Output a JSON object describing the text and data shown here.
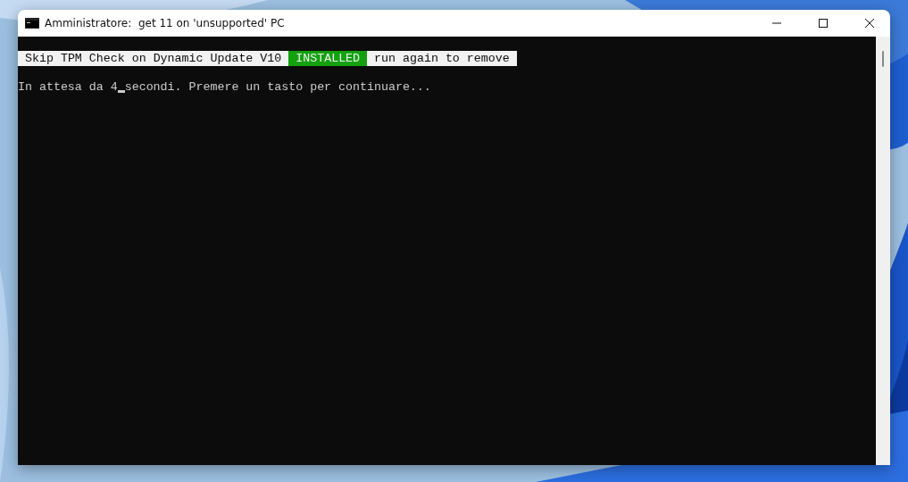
{
  "window": {
    "title": "Amministratore:  get 11 on 'unsupported' PC"
  },
  "console": {
    "banner": [
      {
        "kind": "label",
        "text": "Skip TPM Check on Dynamic Update V10"
      },
      {
        "kind": "status",
        "text": "INSTALLED"
      },
      {
        "kind": "label",
        "text": "run again to remove"
      }
    ],
    "prompt": {
      "before_cursor": "In attesa da 4",
      "after_cursor": "secondi. Premere un tasto per continuare..."
    }
  }
}
